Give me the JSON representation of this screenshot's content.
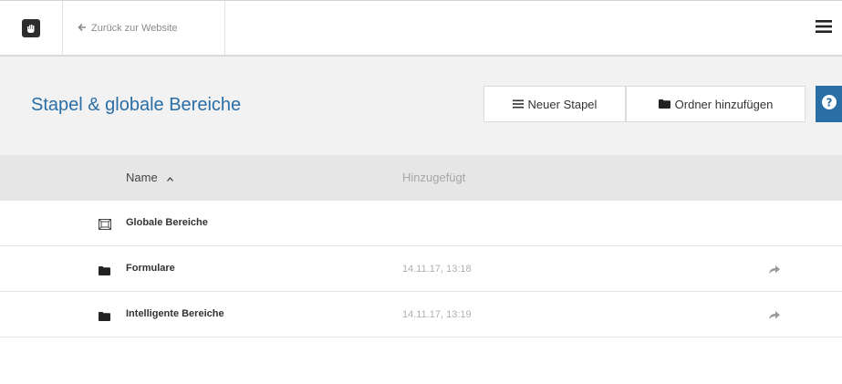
{
  "topbar": {
    "back_label": "Zurück zur Website"
  },
  "header": {
    "title": "Stapel & globale Bereiche",
    "new_stack_label": "Neuer Stapel",
    "add_folder_label": "Ordner hinzufügen",
    "help_label": "?"
  },
  "table": {
    "columns": {
      "name": "Name",
      "added": "Hinzugefügt"
    },
    "rows": [
      {
        "name": "Globale Bereiche",
        "date": "",
        "icon": "global-areas-icon"
      },
      {
        "name": "Formulare",
        "date": "14.11.17, 13:18",
        "icon": "folder-icon"
      },
      {
        "name": "Intelligente Bereiche",
        "date": "14.11.17, 13:19",
        "icon": "folder-icon"
      }
    ]
  },
  "colors": {
    "accent": "#2a6ea6",
    "header_bg": "#f2f2f2",
    "table_head_bg": "#e6e6e6"
  }
}
